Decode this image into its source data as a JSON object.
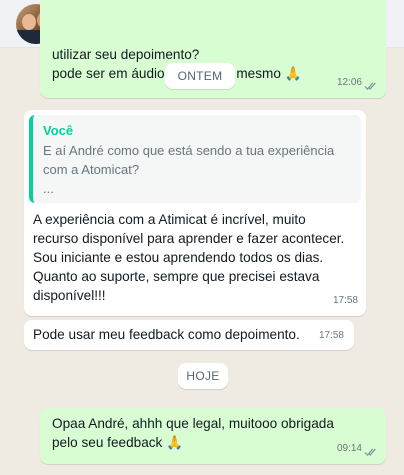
{
  "header": {
    "search_icon": "search-icon",
    "menu_icon": "more-vertical-icon"
  },
  "date_chips": {
    "yesterday": "ONTEM",
    "today": "HOJE"
  },
  "messages": [
    {
      "direction": "out",
      "text": "utilizar seu depoimento?\npode ser em áudio                   mesmo 🙏",
      "time": "12:06",
      "status": "read"
    },
    {
      "direction": "in",
      "quote": {
        "author": "Você",
        "text": "E aí André como que está sendo a tua experiência\ncom a Atomicat?\n..."
      },
      "text": "A experiência com a Atimicat é incrível, muito\nrecurso disponível para aprender e fazer acontecer.\nSou iniciante e estou aprendendo todos os dias.\nQuanto ao suporte, sempre que precisei estava\ndisponível!!!",
      "time": "17:58"
    },
    {
      "direction": "in",
      "text": "Pode usar meu feedback como depoimento.",
      "time": "17:58"
    },
    {
      "direction": "out",
      "text": "Opaa André, ahhh que legal, muitooo obrigada\npelo seu feedback 🙏",
      "time": "09:14",
      "status": "read"
    }
  ],
  "colors": {
    "outgoing_bubble": "#d9fdd3",
    "incoming_bubble": "#ffffff",
    "chat_background": "#efeae2",
    "quote_accent": "#06cf9c",
    "read_ticks": "#8696a0"
  }
}
